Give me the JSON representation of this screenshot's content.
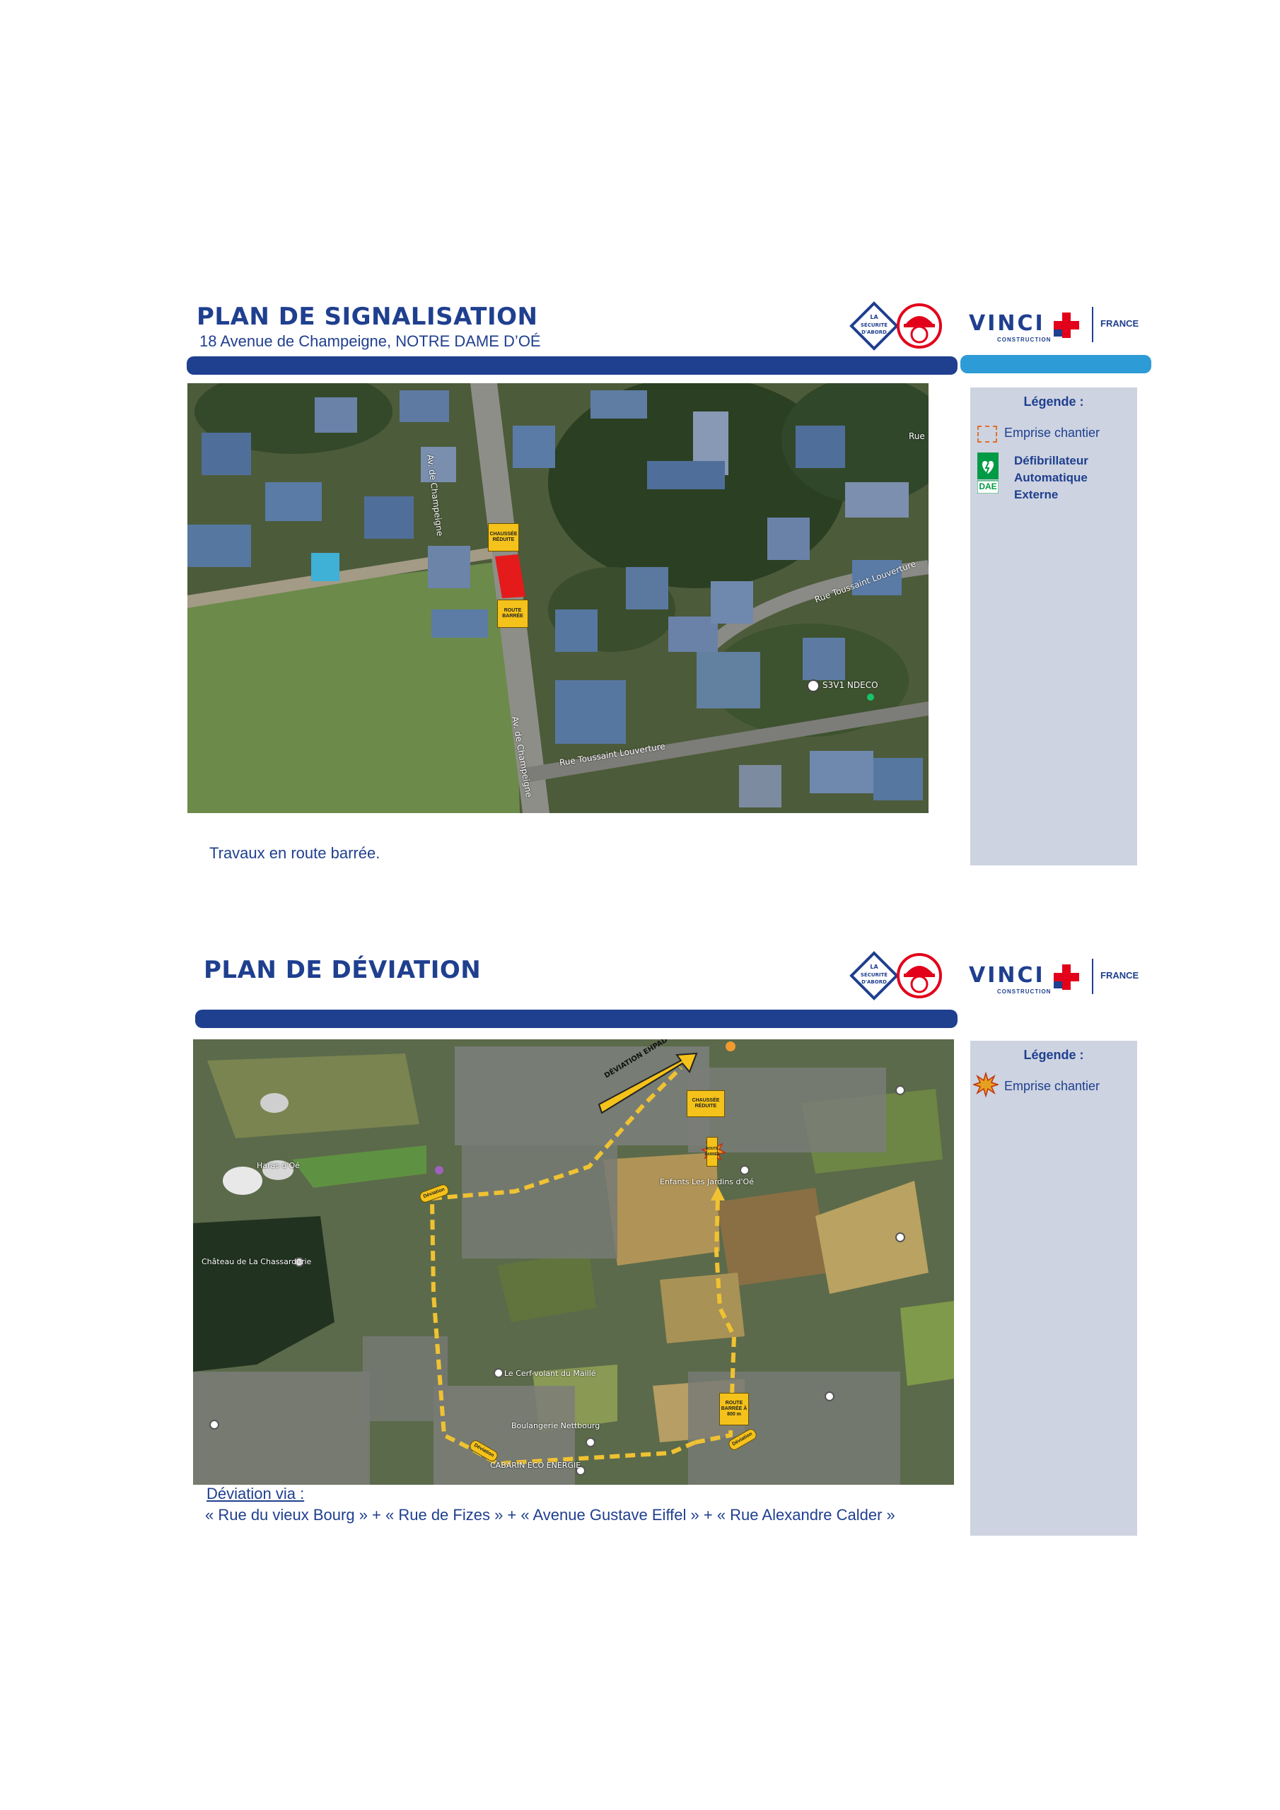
{
  "top": {
    "title": "PLAN DE SIGNALISATION",
    "address": "18 Avenue de Champeigne, NOTRE DAME D’OÉ",
    "note": "Travaux en route barrée.",
    "legend": {
      "title": "Légende :",
      "items": [
        {
          "label": "Emprise chantier"
        },
        {
          "label_lines": [
            "Défibrillateur",
            "Automatique",
            "Externe"
          ],
          "badge": "DAE"
        }
      ]
    },
    "map": {
      "street_1": "Av. de Champeigne",
      "street_2": "Av. de Champeigne",
      "street_3": "Rue Toussaint Louverture",
      "street_4": "Rue Toussaint Louverture",
      "street_5": "Rue",
      "poi": "S3V1 NDECO",
      "sign_top": "CHAUSSÉE RÉDUITE",
      "sign_bottom": "ROUTE BARRÉE"
    }
  },
  "bottom": {
    "title": "PLAN DE DÉVIATION",
    "legend": {
      "title": "Légende :",
      "items": [
        {
          "label": "Emprise chantier"
        }
      ]
    },
    "map": {
      "deviation_label": "DÉVIATION EHPAD",
      "deviation_small_1": "Déviation",
      "deviation_small_2": "Déviation",
      "deviation_small_3": "Déviation",
      "poi_1": "Château de La Chassarderie",
      "poi_2": "Enfants Les Jardins d'Oé",
      "poi_3": "Le Cerf-volant du Maillé",
      "poi_4": "Boulangerie Nettbourg",
      "poi_5": "CABARIN ÉCO ÉNERGIE",
      "poi_6": "Haras d'Oé",
      "sign_a": "ROUTE BARRÉE",
      "sign_b": "ROUTE BARRÉE À 800 m",
      "sign_c": "CHAUSSÉE RÉDUITE"
    },
    "via_title": "Déviation via :",
    "via_text": "« Rue du vieux Bourg » + «  Rue de Fizes » + « Avenue Gustave Eiffel » + « Rue Alexandre Calder »"
  },
  "logos": {
    "safety_text": "LA SÉCURITÉ D'ABORD",
    "vinci": "VINCI",
    "vinci_sub": "CONSTRUCTION",
    "france": "FRANCE"
  },
  "colors": {
    "brand_blue": "#1f3f8f",
    "light_blue": "#2d9bd6",
    "legend_bg": "#cdd3e0",
    "worksite_red": "#e51a1a",
    "sign_yellow": "#f4c21a",
    "vinci_red": "#e2001a",
    "dae_green": "#009a44"
  }
}
